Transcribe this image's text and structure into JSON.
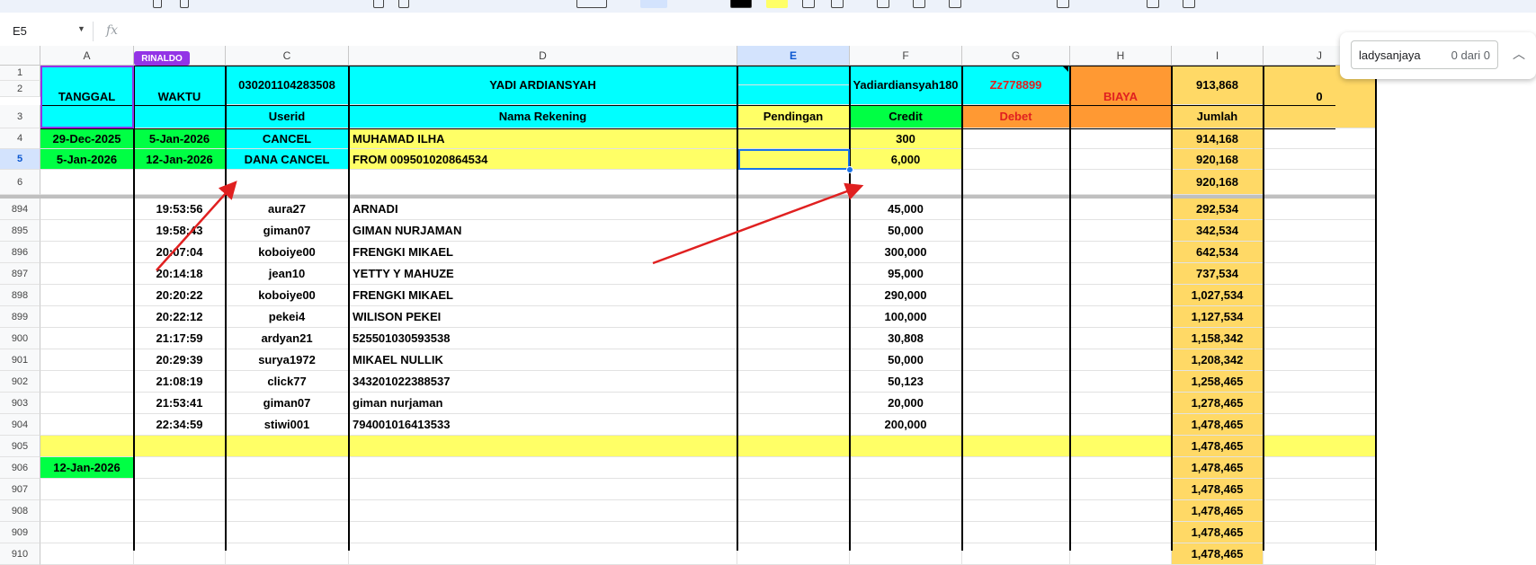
{
  "name_box": {
    "ref": "E5",
    "icon": "dropdown-icon"
  },
  "formula_bar": {
    "fx_label": "fx",
    "content": ""
  },
  "find": {
    "query": "ladysanjaya",
    "count": "0 dari 0",
    "up_icon": "chevron-up-icon"
  },
  "comment_tag": "RINALDO",
  "columns": [
    "A",
    "B",
    "C",
    "D",
    "E",
    "F",
    "G",
    "H",
    "I",
    "J"
  ],
  "header": {
    "tanggal": "TANGGAL",
    "waktu": "WAKTU",
    "account_no": "030201104283508",
    "account_name": "YADI ARDIANSYAH",
    "username": "Yadiardiansyah180",
    "password": "Zz778899",
    "biaya": "BIAYA",
    "balance": "913,868",
    "j_value": "0",
    "userid": "Userid",
    "nama_rekening": "Nama Rekening",
    "pendingan": "Pendingan",
    "credit": "Credit",
    "debet": "Debet",
    "jumlah": "Jumlah"
  },
  "top_rows": [
    {
      "num": "4",
      "tanggal": "29-Dec-2025",
      "waktu": "5-Jan-2026",
      "userid": "CANCEL",
      "nama": "MUHAMAD ILHA",
      "credit": "300",
      "jumlah": "914,168"
    },
    {
      "num": "5",
      "tanggal": "5-Jan-2026",
      "waktu": "12-Jan-2026",
      "userid": "DANA CANCEL",
      "nama": "FROM 009501020864534",
      "credit": "6,000",
      "jumlah": "920,168"
    },
    {
      "num": "6",
      "tanggal": "",
      "waktu": "",
      "userid": "",
      "nama": "",
      "credit": "",
      "jumlah": "920,168"
    }
  ],
  "rows": [
    {
      "num": "894",
      "waktu": "19:53:56",
      "userid": "aura27",
      "nama": "ARNADI",
      "credit": "45,000",
      "jumlah": "292,534"
    },
    {
      "num": "895",
      "waktu": "19:58:43",
      "userid": "giman07",
      "nama": "GIMAN NURJAMAN",
      "credit": "50,000",
      "jumlah": "342,534"
    },
    {
      "num": "896",
      "waktu": "20:07:04",
      "userid": "koboiye00",
      "nama": "FRENGKI MIKAEL",
      "credit": "300,000",
      "jumlah": "642,534"
    },
    {
      "num": "897",
      "waktu": "20:14:18",
      "userid": "jean10",
      "nama": "YETTY Y MAHUZE",
      "credit": "95,000",
      "jumlah": "737,534"
    },
    {
      "num": "898",
      "waktu": "20:20:22",
      "userid": "koboiye00",
      "nama": "FRENGKI MIKAEL",
      "credit": "290,000",
      "jumlah": "1,027,534"
    },
    {
      "num": "899",
      "waktu": "20:22:12",
      "userid": "pekei4",
      "nama": "WILISON PEKEI",
      "credit": "100,000",
      "jumlah": "1,127,534"
    },
    {
      "num": "900",
      "waktu": "21:17:59",
      "userid": "ardyan21",
      "nama": "525501030593538",
      "credit": "30,808",
      "jumlah": "1,158,342"
    },
    {
      "num": "901",
      "waktu": "20:29:39",
      "userid": "surya1972",
      "nama": "MIKAEL NULLIK",
      "credit": "50,000",
      "jumlah": "1,208,342"
    },
    {
      "num": "902",
      "waktu": "21:08:19",
      "userid": "click77",
      "nama": "343201022388537",
      "credit": "50,123",
      "jumlah": "1,258,465"
    },
    {
      "num": "903",
      "waktu": "21:53:41",
      "userid": "giman07",
      "nama": "giman nurjaman",
      "credit": "20,000",
      "jumlah": "1,278,465"
    },
    {
      "num": "904",
      "waktu": "22:34:59",
      "userid": "stiwi001",
      "nama": "794001016413533",
      "credit": "200,000",
      "jumlah": "1,478,465"
    },
    {
      "num": "905",
      "tanggal": "",
      "jumlah": "1,478,465"
    },
    {
      "num": "906",
      "tanggal": "12-Jan-2026",
      "jumlah": "1,478,465"
    },
    {
      "num": "907",
      "jumlah": "1,478,465"
    },
    {
      "num": "908",
      "jumlah": "1,478,465"
    },
    {
      "num": "909",
      "jumlah": "1,478,465"
    },
    {
      "num": "910",
      "jumlah": "1,478,465"
    }
  ],
  "colors": {
    "cyan": "#00ffff",
    "yellow": "#ffff66",
    "green": "#00ff44",
    "orange": "#ff9933",
    "gold": "#ffd966",
    "red": "#e02020",
    "select": "#1a73e8"
  }
}
